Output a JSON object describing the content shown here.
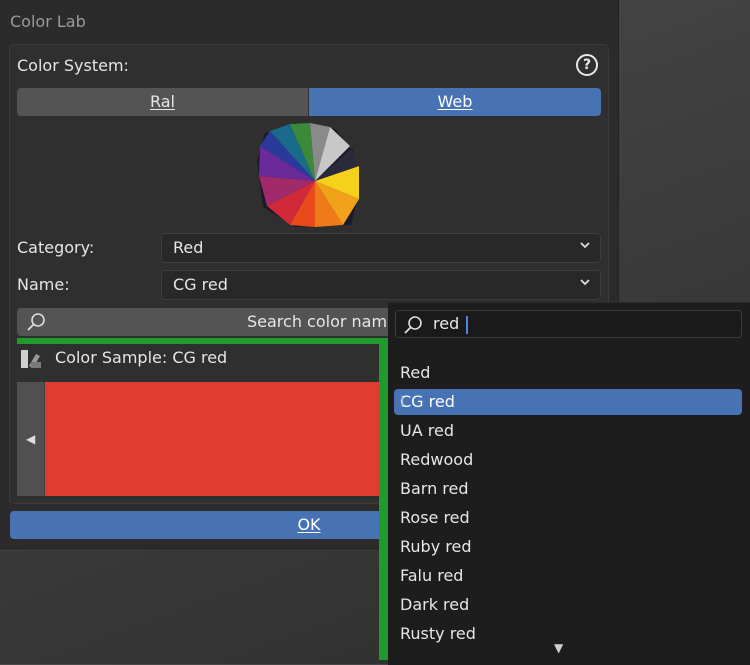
{
  "dialog": {
    "title": "Color Lab",
    "color_system_label": "Color System:",
    "segments": [
      {
        "label": "Ral",
        "selected": false
      },
      {
        "label": "Web",
        "selected": true
      }
    ],
    "category_label": "Category:",
    "category_value": "Red",
    "name_label": "Name:",
    "name_value": "CG red",
    "search_button_label": "Search color nam",
    "sample_header": "Color Sample: CG red",
    "sample_color": "#e03c31",
    "ok_label": "OK"
  },
  "popup": {
    "search_value": "red",
    "options": [
      "Red",
      "CG red",
      "UA red",
      "Redwood",
      "Barn red",
      "Rose red",
      "Ruby red",
      "Falu red",
      "Dark red",
      "Rusty red"
    ],
    "selected": "CG red"
  },
  "colors": {
    "accent": "#4772b3",
    "highlight_green": "#1f9a2d"
  },
  "icons": [
    "help-icon",
    "chevron-down-icon",
    "search-icon",
    "color-sample-icon",
    "arrow-left-icon",
    "scroll-down-icon"
  ]
}
